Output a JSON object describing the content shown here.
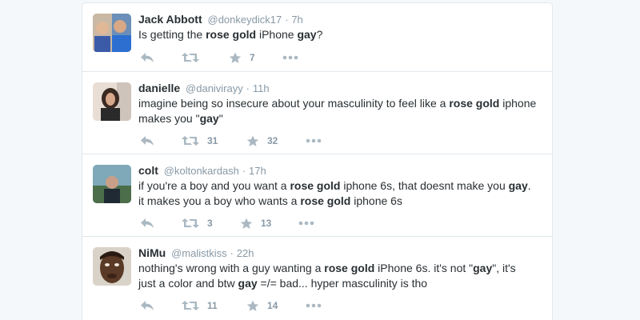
{
  "tweets": [
    {
      "fullname": "Jack Abbott",
      "handle": "@donkeydick17",
      "dot": "·",
      "time": "7h",
      "avatar_icon": "avatar-photo",
      "lines": [
        [
          {
            "t": "Is getting the "
          },
          {
            "t": "rose gold",
            "b": true
          },
          {
            "t": " iPhone "
          },
          {
            "t": "gay",
            "b": true
          },
          {
            "t": "?"
          }
        ]
      ],
      "retweets": "",
      "favorites": "7"
    },
    {
      "fullname": "danielle",
      "handle": "@danivirayy",
      "dot": "·",
      "time": "11h",
      "avatar_icon": "avatar-photo",
      "lines": [
        [
          {
            "t": "imagine being so insecure about your masculinity to feel like a "
          },
          {
            "t": "rose gold",
            "b": true
          },
          {
            "t": " iphone"
          }
        ],
        [
          {
            "t": "makes you \""
          },
          {
            "t": "gay",
            "b": true
          },
          {
            "t": "\""
          }
        ]
      ],
      "retweets": "31",
      "favorites": "32"
    },
    {
      "fullname": "colt",
      "handle": "@koltonkardash",
      "dot": "·",
      "time": "17h",
      "avatar_icon": "avatar-photo",
      "lines": [
        [
          {
            "t": "if you're a boy and you want a "
          },
          {
            "t": "rose gold",
            "b": true
          },
          {
            "t": " iphone 6s, that doesnt make you "
          },
          {
            "t": "gay",
            "b": true
          },
          {
            "t": "."
          }
        ],
        [
          {
            "t": "it makes you a boy who wants a "
          },
          {
            "t": "rose gold",
            "b": true
          },
          {
            "t": " iphone 6s"
          }
        ]
      ],
      "retweets": "3",
      "favorites": "13"
    },
    {
      "fullname": "NiMu",
      "handle": "@malistkiss",
      "dot": "·",
      "time": "22h",
      "avatar_icon": "avatar-photo",
      "lines": [
        [
          {
            "t": "nothing's wrong with a guy wanting a "
          },
          {
            "t": "rose gold",
            "b": true
          },
          {
            "t": " iPhone 6s. it's not \""
          },
          {
            "t": "gay",
            "b": true
          },
          {
            "t": "\", it's"
          }
        ],
        [
          {
            "t": "just a color and btw "
          },
          {
            "t": "gay",
            "b": true
          },
          {
            "t": " =/= bad... hyper masculinity is tho"
          }
        ]
      ],
      "retweets": "11",
      "favorites": "14"
    }
  ],
  "icons": {
    "reply": "reply-icon",
    "retweet": "retweet-icon",
    "favorite": "star-icon",
    "more": "more-icon"
  },
  "colors": {
    "icon": "#aab8c2",
    "count": "#8899a6",
    "text": "#292f33",
    "border": "#e1e8ed",
    "background": "#f5f8fa"
  }
}
